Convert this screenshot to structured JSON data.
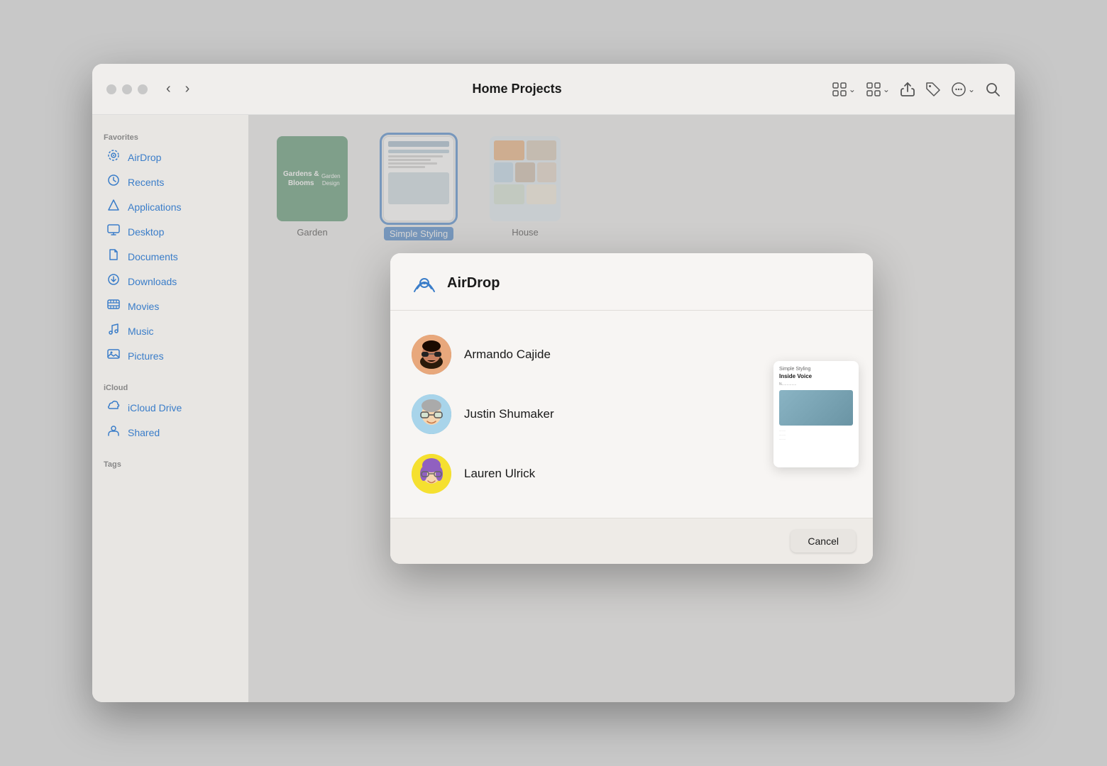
{
  "window": {
    "title": "Home Projects"
  },
  "sidebar": {
    "favorites_label": "Favorites",
    "icloud_label": "iCloud",
    "tags_label": "Tags",
    "items": [
      {
        "id": "airdrop",
        "label": "AirDrop",
        "icon": "📡"
      },
      {
        "id": "recents",
        "label": "Recents",
        "icon": "🕐"
      },
      {
        "id": "applications",
        "label": "Applications",
        "icon": "🚀"
      },
      {
        "id": "desktop",
        "label": "Desktop",
        "icon": "🖥"
      },
      {
        "id": "documents",
        "label": "Documents",
        "icon": "📄"
      },
      {
        "id": "downloads",
        "label": "Downloads",
        "icon": "⬇"
      },
      {
        "id": "movies",
        "label": "Movies",
        "icon": "🎬"
      },
      {
        "id": "music",
        "label": "Music",
        "icon": "🎵"
      },
      {
        "id": "pictures",
        "label": "Pictures",
        "icon": "🖼"
      }
    ],
    "icloud_items": [
      {
        "id": "icloud-drive",
        "label": "iCloud Drive",
        "icon": "☁"
      },
      {
        "id": "shared",
        "label": "Shared",
        "icon": "📁"
      }
    ]
  },
  "files": [
    {
      "id": "garden",
      "name": "Garden",
      "selected": false,
      "type": "garden"
    },
    {
      "id": "styling",
      "name": "Simple Styling",
      "selected": true,
      "type": "styling"
    },
    {
      "id": "house",
      "name": "House",
      "selected": false,
      "type": "house"
    }
  ],
  "airdrop_modal": {
    "title": "AirDrop",
    "contacts": [
      {
        "id": "armando",
        "name": "Armando Cajide",
        "avatar_type": "armando"
      },
      {
        "id": "justin",
        "name": "Justin Shumaker",
        "avatar_type": "justin"
      },
      {
        "id": "lauren",
        "name": "Lauren Ulrick",
        "avatar_type": "lauren"
      }
    ],
    "preview": {
      "subtitle": "Simple Styling",
      "heading": "Inside Voice",
      "body": "N",
      "image_alt": "room preview"
    },
    "cancel_label": "Cancel"
  },
  "toolbar": {
    "back_label": "‹",
    "forward_label": "›"
  }
}
